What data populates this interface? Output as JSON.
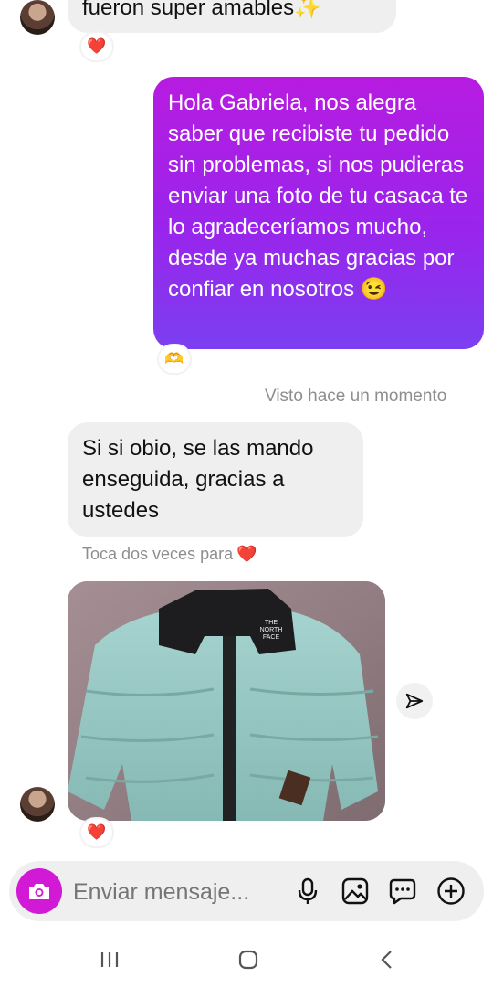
{
  "messages": {
    "top_incoming_tail": "fueron super amables✨",
    "top_reaction": "❤️",
    "outgoing_text": "Hola Gabriela, nos alegra saber que recibiste tu pedido sin problemas, si nos pudieras enviar una foto de tu casaca te lo agradeceríamos mucho, desde ya muchas gracias por confiar en nosotros 😉",
    "outgoing_reaction": "🫶",
    "seen_status": "Visto hace un momento",
    "incoming_text": "Si si obio, se las mando enseguida, gracias a ustedes",
    "double_tap_hint": "Toca dos veces para",
    "double_tap_heart": "❤️",
    "photo_reaction": "❤️",
    "photo_label": "THE NORTH FACE"
  },
  "composer": {
    "placeholder": "Enviar mensaje..."
  },
  "icons": {
    "camera": "camera-icon",
    "mic": "microphone-icon",
    "gallery": "gallery-icon",
    "sticker": "sticker-icon",
    "plus": "plus-icon",
    "share": "share-icon",
    "nav_recent": "recent-apps-icon",
    "nav_home": "home-icon",
    "nav_back": "back-icon"
  },
  "colors": {
    "outgoing_top": "#b71ce0",
    "outgoing_bottom": "#7b3ff0",
    "camera_button": "#d21ad6",
    "incoming_bubble": "#efefef"
  }
}
